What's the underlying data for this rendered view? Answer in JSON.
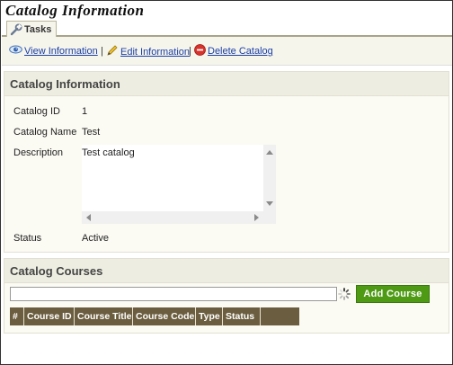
{
  "page": {
    "title": "Catalog Information"
  },
  "tabs": [
    {
      "label": "Tasks"
    }
  ],
  "toolbar": {
    "view_label": "View Information",
    "edit_label": "Edit Information",
    "delete_label": "Delete Catalog",
    "separator": "|"
  },
  "info_panel": {
    "title": "Catalog Information",
    "fields": {
      "catalog_id": {
        "label": "Catalog ID",
        "value": "1"
      },
      "catalog_name": {
        "label": "Catalog Name",
        "value": "Test"
      },
      "description": {
        "label": "Description",
        "value": "Test catalog"
      },
      "status": {
        "label": "Status",
        "value": "Active"
      }
    }
  },
  "courses_panel": {
    "title": "Catalog Courses",
    "search": {
      "value": "",
      "placeholder": ""
    },
    "add_button_label": "Add Course",
    "columns": [
      "#",
      "Course ID",
      "Course Title",
      "Course Code",
      "Type",
      "Status"
    ]
  },
  "colors": {
    "link": "#1a3fa8",
    "accent_green": "#4e9a14",
    "grid_header": "#6b5d3f",
    "panel_header": "#eeede1"
  },
  "icons": [
    "wrench-icon",
    "eye-icon",
    "pencil-icon",
    "delete-icon",
    "spinner-icon"
  ]
}
